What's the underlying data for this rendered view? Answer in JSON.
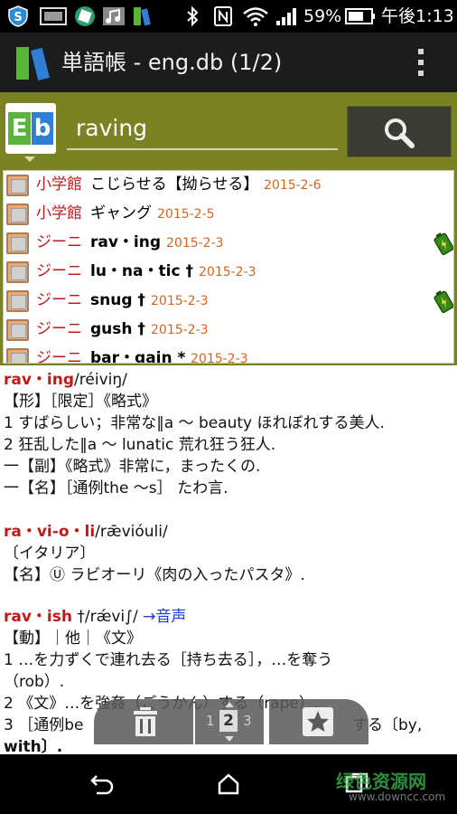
{
  "status_bar": {
    "battery_percent": "59%",
    "time": "午後1:13"
  },
  "action_bar": {
    "title": "単語帳 - eng.db (1/2)"
  },
  "search": {
    "logo_e": "E",
    "logo_b": "b",
    "value": "raving"
  },
  "history": [
    {
      "source": "小学館",
      "word": "こじらせる【拗らせる】",
      "date": "2015-2-6",
      "bold": false,
      "battery": false
    },
    {
      "source": "小学館",
      "word": "ギャング",
      "date": "2015-2-5",
      "bold": false,
      "battery": false
    },
    {
      "source": "ジーニ",
      "word": "rav・ing",
      "date": "2015-2-3",
      "bold": true,
      "battery": true
    },
    {
      "source": "ジーニ",
      "word": "lu・na・tic †",
      "date": "2015-2-3",
      "bold": true,
      "battery": false
    },
    {
      "source": "ジーニ",
      "word": "snug †",
      "date": "2015-2-3",
      "bold": true,
      "battery": true
    },
    {
      "source": "ジーニ",
      "word": "gush †",
      "date": "2015-2-3",
      "bold": true,
      "battery": false
    },
    {
      "source": "ジーニ",
      "word": "bar・gain *",
      "date": "2015-2-3",
      "bold": true,
      "battery": false
    }
  ],
  "entry": {
    "e1_head": "rav・ing",
    "e1_pron": "/réiviŋ/",
    "e1_l2": "【形】［限定］《略式》",
    "e1_l3": "1 すばらしい；非常な‖a ～ beauty ほれぼれする美人.",
    "e1_l4": "2 狂乱した‖a ～ lunatic 荒れ狂う狂人.",
    "e1_l5": "一【副】《略式》非常に，まったくの.",
    "e1_l6": "一【名】［通例the ～s］ たわ言.",
    "e2_head": "ra・vi-o・li",
    "e2_pron": "/rǣvióuli/",
    "e2_l2": "〔イタリア〕",
    "e2_l3": "【名】Ⓤ ラビオーリ《肉の入ったパスタ》.",
    "e3_head": "rav・ish",
    "e3_pron": " †/rǽvi∫/",
    "e3_link": "→音声",
    "e3_l2": "【動】｜他｜《文》",
    "e3_l3": "1 …を力ずくで連れ去る［持ち去る］，…を奪う",
    "e3_l4": "（rob）.",
    "e3_l5": "2 《文》…を強姦（ごうかん）する（rape）.",
    "e3_l6a": "3 ［通例be",
    "e3_l6b": "する〔by,",
    "e3_l7": "with〕."
  },
  "toolbar": {
    "page_prev": "1",
    "page_current": "2",
    "page_next": "3"
  },
  "watermark": {
    "cn": "绿色资源网",
    "url": "www.downcc.com"
  }
}
